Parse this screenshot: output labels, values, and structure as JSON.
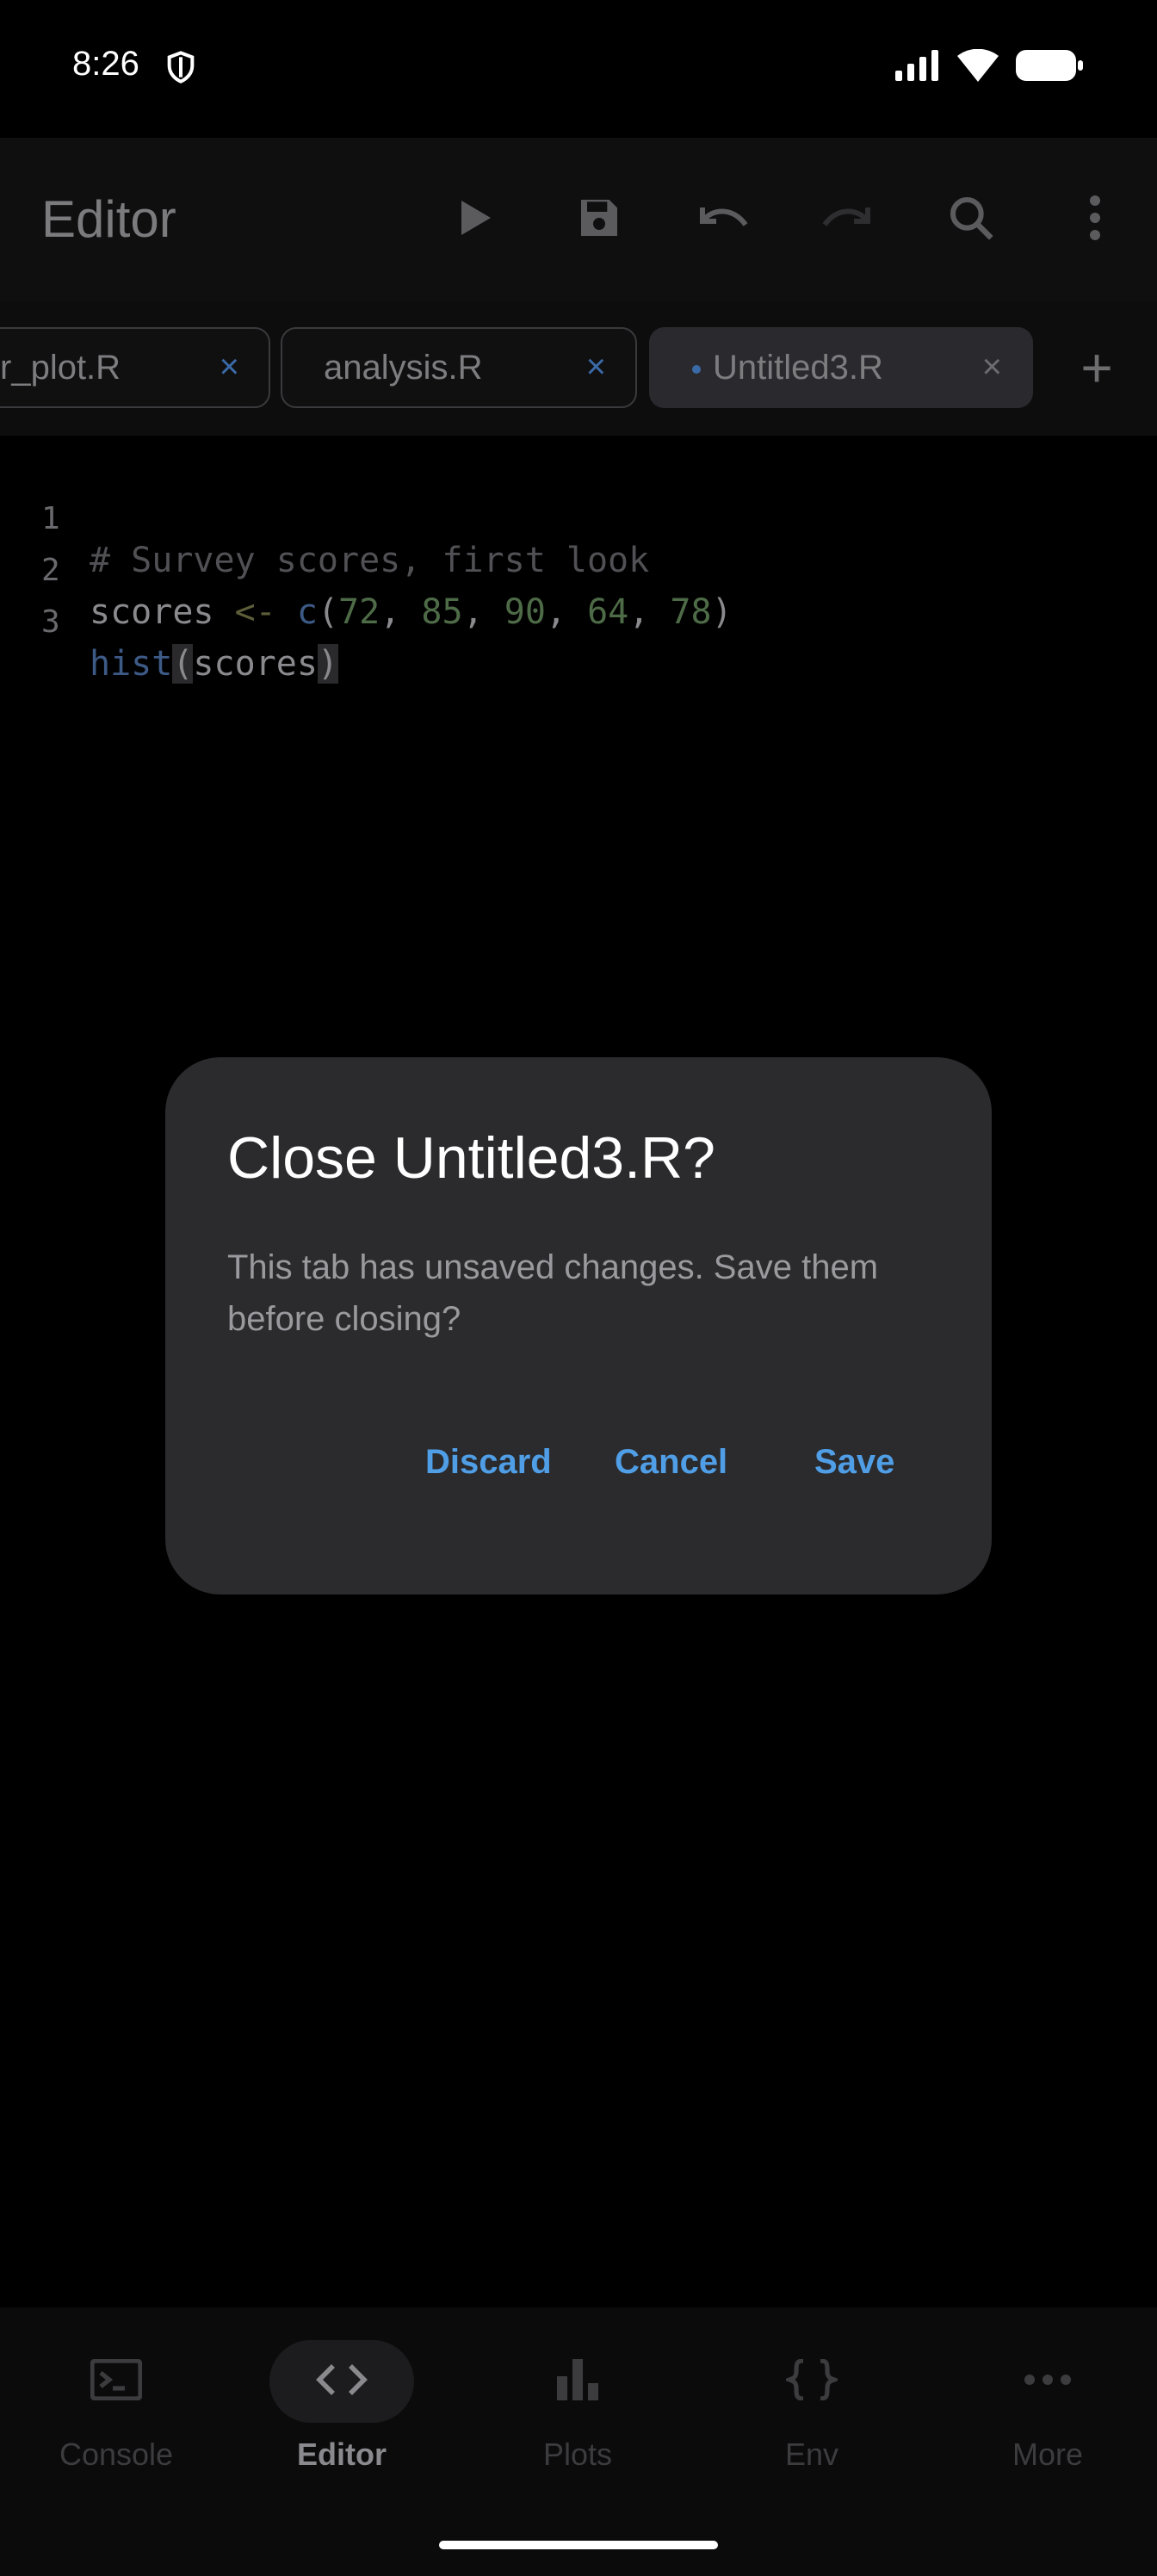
{
  "status": {
    "time": "8:26"
  },
  "appbar": {
    "title": "Editor",
    "actions": [
      "run-icon",
      "save-icon",
      "undo-icon",
      "redo-icon",
      "search-icon",
      "more-vert-icon"
    ]
  },
  "tabs": [
    {
      "label": "r_plot.R",
      "close": "×"
    },
    {
      "label": "analysis.R",
      "close": "×"
    },
    {
      "label": "Untitled3.R",
      "close": "×",
      "unsaved": true
    }
  ],
  "add_tab": "+",
  "editor": {
    "lines": [
      {
        "num": "1",
        "comment": "# Survey scores, first look"
      },
      {
        "num": "2",
        "id": "scores",
        "op": "<-",
        "fn": "c",
        "args": [
          "72",
          "85",
          "90",
          "64",
          "78"
        ]
      },
      {
        "num": "3",
        "fn": "hist",
        "arg": "scores"
      }
    ]
  },
  "dialog": {
    "title": "Close Untitled3.R?",
    "body": "This tab has unsaved changes. Save them before closing?",
    "discard": "Discard",
    "cancel": "Cancel",
    "save": "Save"
  },
  "bottom_nav": [
    {
      "label": "Console",
      "icon": "console-icon"
    },
    {
      "label": "Editor",
      "icon": "code-icon",
      "active": true
    },
    {
      "label": "Plots",
      "icon": "bar-chart-icon"
    },
    {
      "label": "Env",
      "icon": "braces-icon"
    },
    {
      "label": "More",
      "icon": "more-horiz-icon"
    }
  ],
  "colors": {
    "accent": "#4f9ee6",
    "dialog_bg": "#2b2b2e",
    "background": "#000000"
  }
}
